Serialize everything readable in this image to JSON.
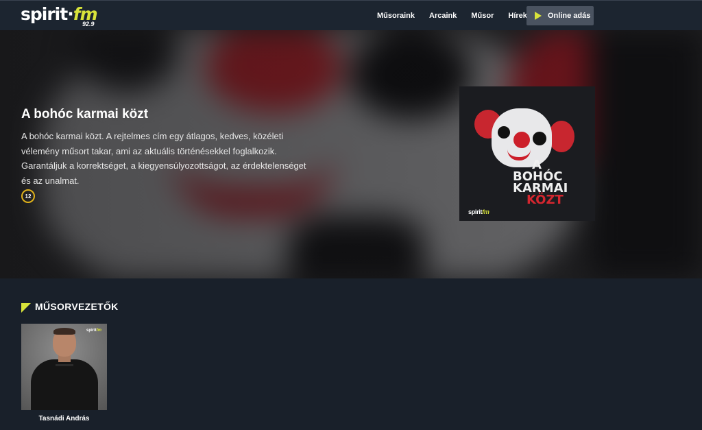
{
  "nav": {
    "logo_text": "spirit",
    "logo_fm": "fm",
    "logo_freq": "92.9",
    "links": [
      "Műsoraink",
      "Arcaink",
      "Műsor",
      "Hírek"
    ],
    "cta_label": "Online adás"
  },
  "hero": {
    "title": "A bohóc karmai közt",
    "description": "A bohóc karmai közt. A rejtelmes cím egy átlagos, kedves, közéleti vélemény műsort takar, ami az aktuális történésekkel foglalkozik. Garantáljuk a korrektséget, a kiegyensúlyozottságot, az érdektelenséget és az unalmat.",
    "age_rating": "12",
    "cover": {
      "line1": "A",
      "line2": "Bohóc",
      "line3": "Karmai",
      "line4": "Közt",
      "logo_text": "spirit",
      "logo_fm": "fm"
    }
  },
  "hosts": {
    "section_title": "MŰSORVEZETŐK",
    "items": [
      {
        "name": "Tasnádi András",
        "badge_text": "spirit",
        "badge_fm": "fm"
      }
    ]
  },
  "colors": {
    "accent": "#d8e33a",
    "nav_bg": "#1c2530",
    "page_bg": "#19202a",
    "badge_ring": "#e0b21a"
  }
}
